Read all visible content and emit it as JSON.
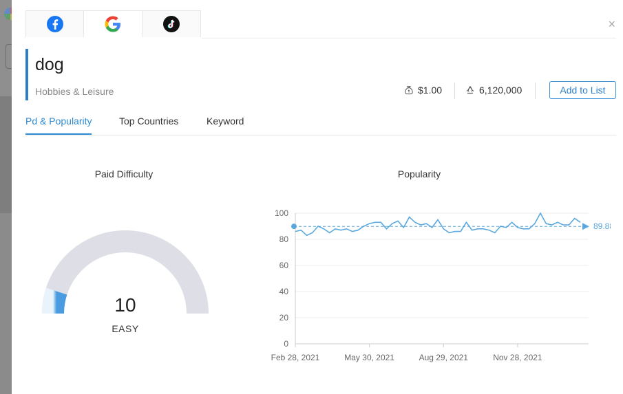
{
  "social_tabs": [
    {
      "name": "facebook",
      "icon": "facebook-icon",
      "color": "#1877f2"
    },
    {
      "name": "google",
      "icon": "google-icon"
    },
    {
      "name": "tiktok",
      "icon": "tiktok-icon",
      "color": "#111111"
    }
  ],
  "close_label": "×",
  "keyword": {
    "title": "dog",
    "category": "Hobbies & Leisure",
    "cpc": "$1.00",
    "volume": "6,120,000",
    "add_button": "Add to List"
  },
  "sub_tabs": [
    {
      "label": "Pd & Popularity",
      "active": true
    },
    {
      "label": "Top Countries",
      "active": false
    },
    {
      "label": "Keyword",
      "active": false
    }
  ],
  "paid_difficulty": {
    "title": "Paid Difficulty",
    "value": "10",
    "level": "EASY",
    "fraction": 0.1,
    "track_color": "#dedfe6",
    "fill_color": "#4a9be0"
  },
  "popularity": {
    "title": "Popularity",
    "average_label": "89.88",
    "color": "#5aa8df"
  },
  "chart_data": {
    "type": "line",
    "title": "Popularity",
    "x_ticks": [
      "Feb 28, 2021",
      "May 30, 2021",
      "Aug 29, 2021",
      "Nov 28, 2021"
    ],
    "y_ticks": [
      0,
      20,
      40,
      60,
      80,
      100
    ],
    "ylim": [
      0,
      100
    ],
    "average": 89.88,
    "series": [
      {
        "values": [
          86,
          87,
          83,
          85,
          90,
          88,
          85,
          88,
          87,
          88,
          86,
          87,
          90,
          92,
          93,
          93,
          88,
          92,
          94,
          89,
          97,
          93,
          91,
          92,
          89,
          95,
          88,
          85,
          86,
          86,
          93,
          87,
          88,
          88,
          87,
          85,
          90,
          89,
          93,
          89,
          88,
          88,
          92,
          100,
          92,
          91,
          93,
          91,
          91,
          96,
          93
        ]
      }
    ]
  }
}
